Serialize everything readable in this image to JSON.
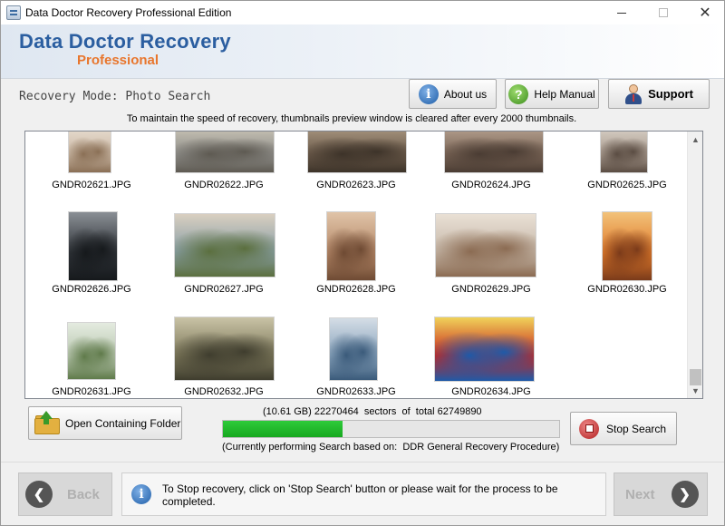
{
  "window": {
    "title": "Data Doctor Recovery Professional Edition",
    "controls": {
      "minimize": "—",
      "maximize": "☐",
      "close": "✕"
    }
  },
  "banner": {
    "title": "Data Doctor Recovery",
    "subtitle": "Professional"
  },
  "mode": {
    "label": "Recovery Mode: Photo Search"
  },
  "toolbar": {
    "about_label": "About us",
    "help_label": "Help Manual",
    "support_label": "Support",
    "about_icon": "info-icon",
    "help_icon": "question-icon",
    "support_icon": "person-icon"
  },
  "notice": "To maintain the speed of recovery, thumbnails preview window is cleared after every 2000 thumbnails.",
  "thumbnails": [
    {
      "name": "GNDR02621.JPG",
      "colors": [
        "#c9b7a4",
        "#8a6f55",
        "#e8ddd0"
      ]
    },
    {
      "name": "GNDR02622.JPG",
      "colors": [
        "#8f8e8a",
        "#5e5a52",
        "#c8c3b5"
      ]
    },
    {
      "name": "GNDR02623.JPG",
      "colors": [
        "#6b5a4a",
        "#3d3329",
        "#a89680"
      ]
    },
    {
      "name": "GNDR02624.JPG",
      "colors": [
        "#7a6556",
        "#4a3c33",
        "#b5a08f"
      ]
    },
    {
      "name": "GNDR02625.JPG",
      "colors": [
        "#a89a8e",
        "#5a4c42",
        "#d8d0c6"
      ]
    },
    {
      "name": "GNDR02626.JPG",
      "colors": [
        "#2f3338",
        "#16191c",
        "#8a8f95"
      ]
    },
    {
      "name": "GNDR02627.JPG",
      "colors": [
        "#8aa0a8",
        "#5b6f3e",
        "#d9cfc0"
      ]
    },
    {
      "name": "GNDR02628.JPG",
      "colors": [
        "#b58868",
        "#6e4a33",
        "#e0c4a8"
      ]
    },
    {
      "name": "GNDR02629.JPG",
      "colors": [
        "#c7b9aa",
        "#8b6b52",
        "#e9e0d5"
      ]
    },
    {
      "name": "GNDR02630.JPG",
      "colors": [
        "#e07a2a",
        "#7a3a1a",
        "#f2c27a"
      ]
    },
    {
      "name": "GNDR02631.JPG",
      "colors": [
        "#b9c7b0",
        "#5f7a4a",
        "#e4ebe0"
      ]
    },
    {
      "name": "GNDR02632.JPG",
      "colors": [
        "#7f7a5c",
        "#3f3d2e",
        "#c9c3a6"
      ]
    },
    {
      "name": "GNDR02633.JPG",
      "colors": [
        "#8aa4bc",
        "#3a5a7a",
        "#d4dde6"
      ]
    },
    {
      "name": "GNDR02634.JPG",
      "colors": [
        "#c8261d",
        "#1f5aa8",
        "#f0d35a"
      ]
    }
  ],
  "progress": {
    "sector_text": "(10.61 GB) 22270464  sectors  of  total 62749890",
    "fraction": 0.3549,
    "procedure_text": "(Currently performing Search based on:  DDR General Recovery Procedure)"
  },
  "actions": {
    "open_folder_label": "Open Containing Folder",
    "stop_label": "Stop Search",
    "open_folder_icon": "folder-icon",
    "stop_icon": "stop-icon"
  },
  "footer": {
    "back_label": "Back",
    "next_label": "Next",
    "info_text": "To Stop recovery, click on 'Stop Search' button or please wait for the process to be completed.",
    "back_icon": "chevron-left-icon",
    "next_icon": "chevron-right-icon",
    "info_icon": "info-icon"
  }
}
